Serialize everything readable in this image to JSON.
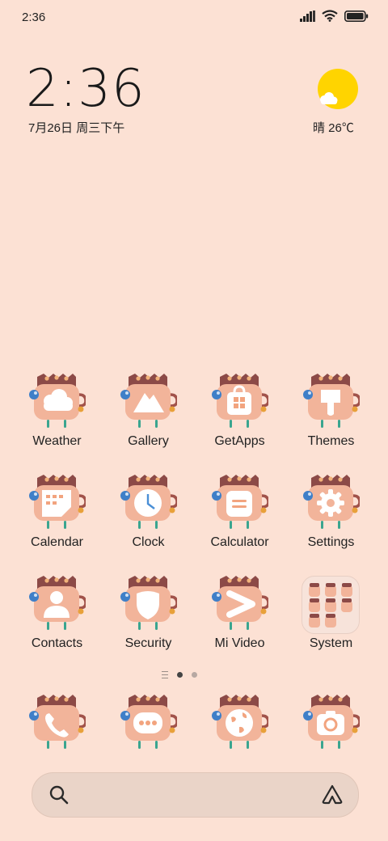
{
  "status_bar": {
    "time": "2:36"
  },
  "clock_widget": {
    "time": "2:36",
    "date": "7月26日 周三下午"
  },
  "weather_widget": {
    "text": "晴 26℃",
    "icon": "sunny-partly-cloudy-icon"
  },
  "apps": [
    {
      "label": "Weather",
      "icon": "cloud-icon"
    },
    {
      "label": "Gallery",
      "icon": "mountain-icon"
    },
    {
      "label": "GetApps",
      "icon": "shopping-bag-icon"
    },
    {
      "label": "Themes",
      "icon": "brush-icon"
    },
    {
      "label": "Calendar",
      "icon": "calendar-icon"
    },
    {
      "label": "Clock",
      "icon": "clock-icon"
    },
    {
      "label": "Calculator",
      "icon": "calculator-icon"
    },
    {
      "label": "Settings",
      "icon": "gear-icon"
    },
    {
      "label": "Contacts",
      "icon": "person-icon"
    },
    {
      "label": "Security",
      "icon": "shield-icon"
    },
    {
      "label": "Mi Video",
      "icon": "play-icon"
    },
    {
      "label": "System",
      "icon": "folder-icon"
    }
  ],
  "dock": [
    {
      "name": "Phone",
      "icon": "phone-icon"
    },
    {
      "name": "Messages",
      "icon": "chat-bubble-icon"
    },
    {
      "name": "Browser",
      "icon": "globe-icon"
    },
    {
      "name": "Camera",
      "icon": "camera-icon"
    }
  ],
  "page_indicator": {
    "pages": 2,
    "current": 1
  },
  "colors": {
    "background": "#fce1d4",
    "icon_body": "#f2b49a",
    "icon_crown": "#8c4a47",
    "sun": "#ffd400",
    "search_bar": "#ead4c8"
  }
}
